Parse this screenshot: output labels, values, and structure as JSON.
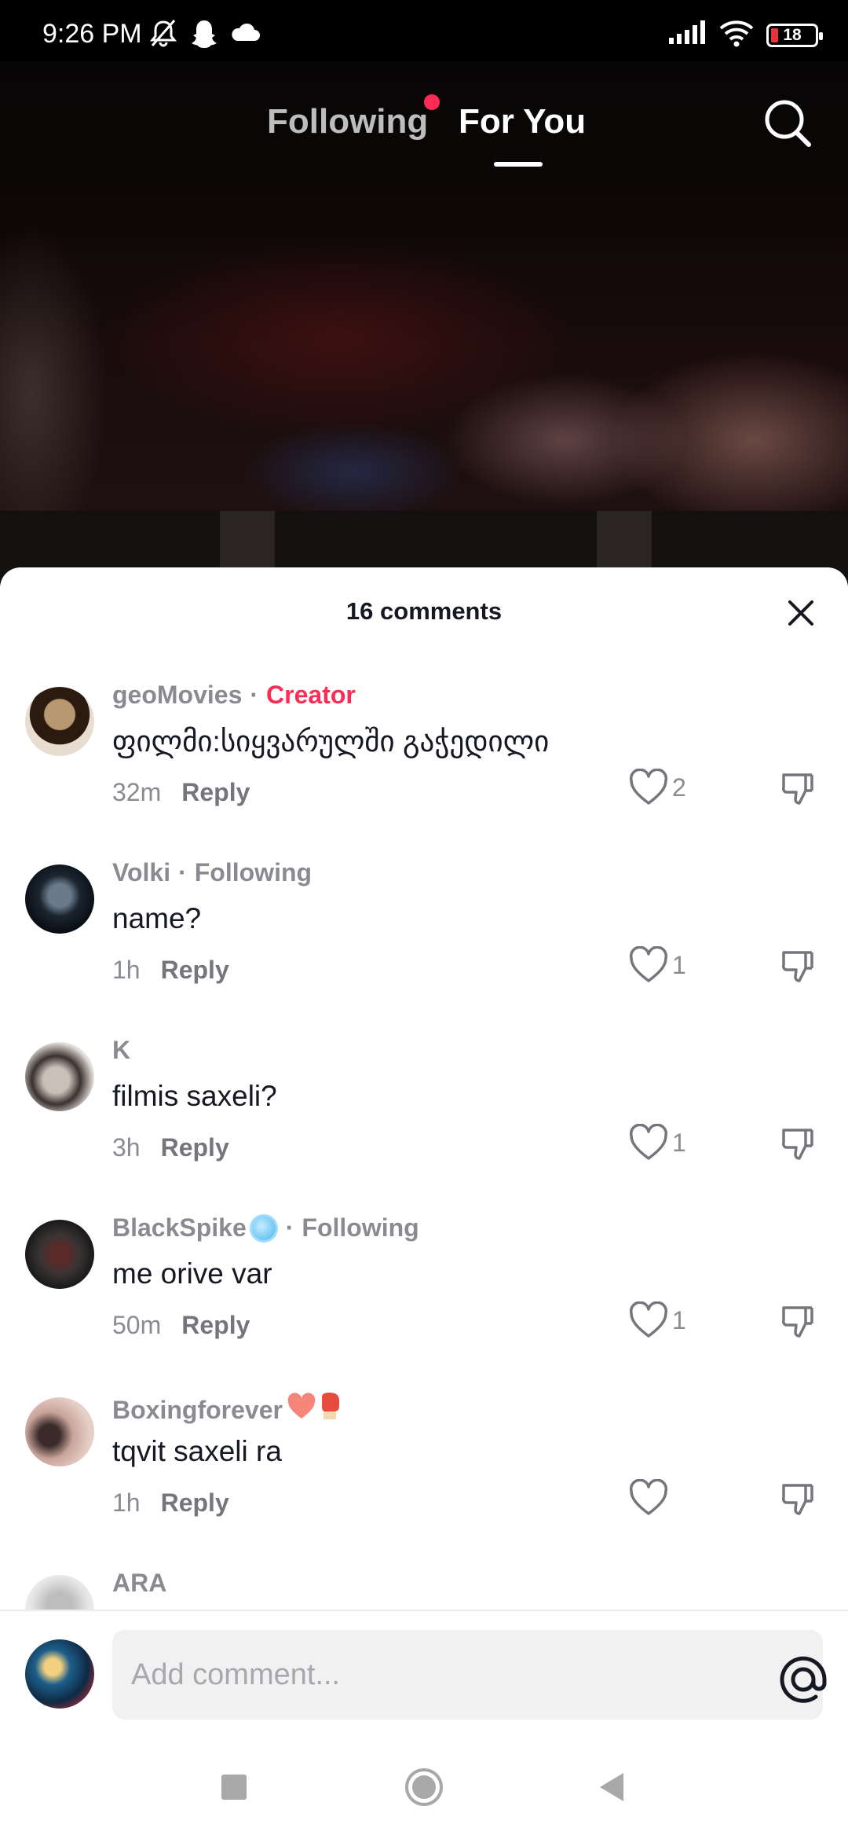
{
  "status_bar": {
    "time": "9:26 PM",
    "battery_level": "18",
    "icons": [
      "mute-bell-icon",
      "snapchat-icon",
      "cloud-icon",
      "signal-icon",
      "wifi-icon",
      "battery-icon"
    ]
  },
  "top_nav": {
    "tabs": [
      {
        "label": "Following",
        "has_dot": true,
        "active": false
      },
      {
        "label": "For You",
        "active": true
      }
    ],
    "search_icon": "search-icon"
  },
  "comments_sheet": {
    "title": "16 comments",
    "comments": [
      {
        "user": "geoMovies",
        "tag": "Creator",
        "text": "ფილმი:სიყვარულში გაჭედილი",
        "time": "32m",
        "reply": "Reply",
        "likes": "2"
      },
      {
        "user": "Volki",
        "tag": "Following",
        "text": "name?",
        "time": "1h",
        "reply": "Reply",
        "likes": "1"
      },
      {
        "user": "K",
        "tag": "",
        "text": "filmis saxeli?",
        "time": "3h",
        "reply": "Reply",
        "likes": "1"
      },
      {
        "user": "BlackSpike",
        "tag": "Following",
        "text": "me orive var",
        "time": "50m",
        "reply": "Reply",
        "likes": "1"
      },
      {
        "user": "Boxingforever",
        "tag": "",
        "text": "tqvit saxeli ra",
        "time": "1h",
        "reply": "Reply",
        "likes": ""
      },
      {
        "user": "ARA",
        "tag": "",
        "text": "",
        "time": "",
        "reply": "",
        "likes": ""
      }
    ]
  },
  "input_bar": {
    "placeholder": "Add comment...",
    "icons": [
      "at-icon",
      "emoji-icon"
    ]
  },
  "nav_bar": {
    "icons": [
      "recents-square-icon",
      "home-circle-icon",
      "back-triangle-icon"
    ]
  },
  "colors": {
    "accent": "#fe2c55",
    "muted_text": "#8a8b91",
    "body_text": "#161823"
  }
}
